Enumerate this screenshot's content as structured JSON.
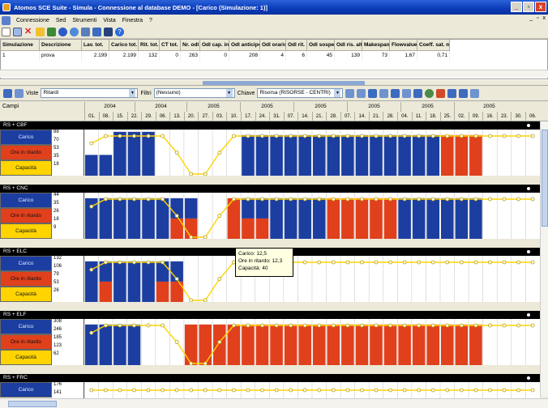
{
  "window": {
    "title": "Atomos SCE Suite - Simula - Connessione al database DEMO - [Carico (Simulazione: 1)]",
    "minimize": "_",
    "restore": "▫",
    "close": "x"
  },
  "menu": {
    "items": [
      "Connessione",
      "Sed",
      "Strumenti",
      "Vista",
      "Finestra",
      "?"
    ],
    "mdi": [
      "_",
      "▫",
      "x"
    ]
  },
  "grid": {
    "headers": [
      "Simulazione",
      "Descrizione",
      "Lav. tot.",
      "Carico tot.",
      "Rit. tot.",
      "CT tot.",
      "Nr. odl",
      "Odl cap. inf.",
      "Odl anticipo",
      "Odl orario",
      "Odl rit.",
      "Odl sospesi",
      "Odl ris. alt.",
      "Makespan",
      "Flowvalue",
      "Coeff. sat. m"
    ],
    "row": [
      "1",
      "prova",
      "2.199",
      "2.199",
      "132",
      "0",
      "263",
      "0",
      "208",
      "4",
      "6",
      "45",
      "139",
      "73",
      "1,67",
      "0,71"
    ]
  },
  "toolbar2": {
    "viste_label": "Viste",
    "viste_value": "Ritardi",
    "filtri_label": "Filtri",
    "filtri_value": "(Nessuno)",
    "chiave_label": "Chiave",
    "chiave_value": "Risorsa (RISORSE - CENTRI)"
  },
  "timeline": {
    "campi": "Campi",
    "years": [
      "2004",
      "2004",
      "2005",
      "2005",
      "2005",
      "2005",
      "2005",
      "2005"
    ],
    "days": [
      "01.",
      "08.",
      "15.",
      "22.",
      "29.",
      "06.",
      "13.",
      "20.",
      "27.",
      "03.",
      "10.",
      "17.",
      "24.",
      "31.",
      "07.",
      "14.",
      "21.",
      "28.",
      "07.",
      "14.",
      "21.",
      "28.",
      "04.",
      "11.",
      "18.",
      "25.",
      "02.",
      "09.",
      "16.",
      "23.",
      "30.",
      "06."
    ]
  },
  "colors": {
    "carico": "#1c3ea0",
    "ritardo": "#e0401c",
    "capacita": "#ffd400"
  },
  "sections": [
    {
      "name": "RS + CBF",
      "labels": [
        "Carico",
        "Ore in ritardo",
        "Capacità"
      ],
      "ticks": [
        "88",
        "70",
        "53",
        "35",
        "18"
      ]
    },
    {
      "name": "RS + CNC",
      "labels": [
        "Carico",
        "Ore in ritardo",
        "Capacità"
      ],
      "ticks": [
        "44",
        "35",
        "26",
        "18",
        "9"
      ]
    },
    {
      "name": "RS + ELC",
      "labels": [
        "Carico",
        "Ore in ritardo",
        "Capacità"
      ],
      "ticks": [
        "132",
        "106",
        "79",
        "53",
        "26"
      ]
    },
    {
      "name": "RS + ELF",
      "labels": [
        "Carico",
        "Ore in ritardo",
        "Capacità"
      ],
      "ticks": [
        "308",
        "246",
        "185",
        "123",
        "62"
      ]
    },
    {
      "name": "RS + FRC",
      "labels": [
        "Carico"
      ],
      "ticks": [
        "176",
        "141"
      ]
    }
  ],
  "tooltip": {
    "line1": "Carico: 12,5",
    "line2": "Ore in ritardo: 12,3",
    "line3": "Capacità: 40"
  }
}
